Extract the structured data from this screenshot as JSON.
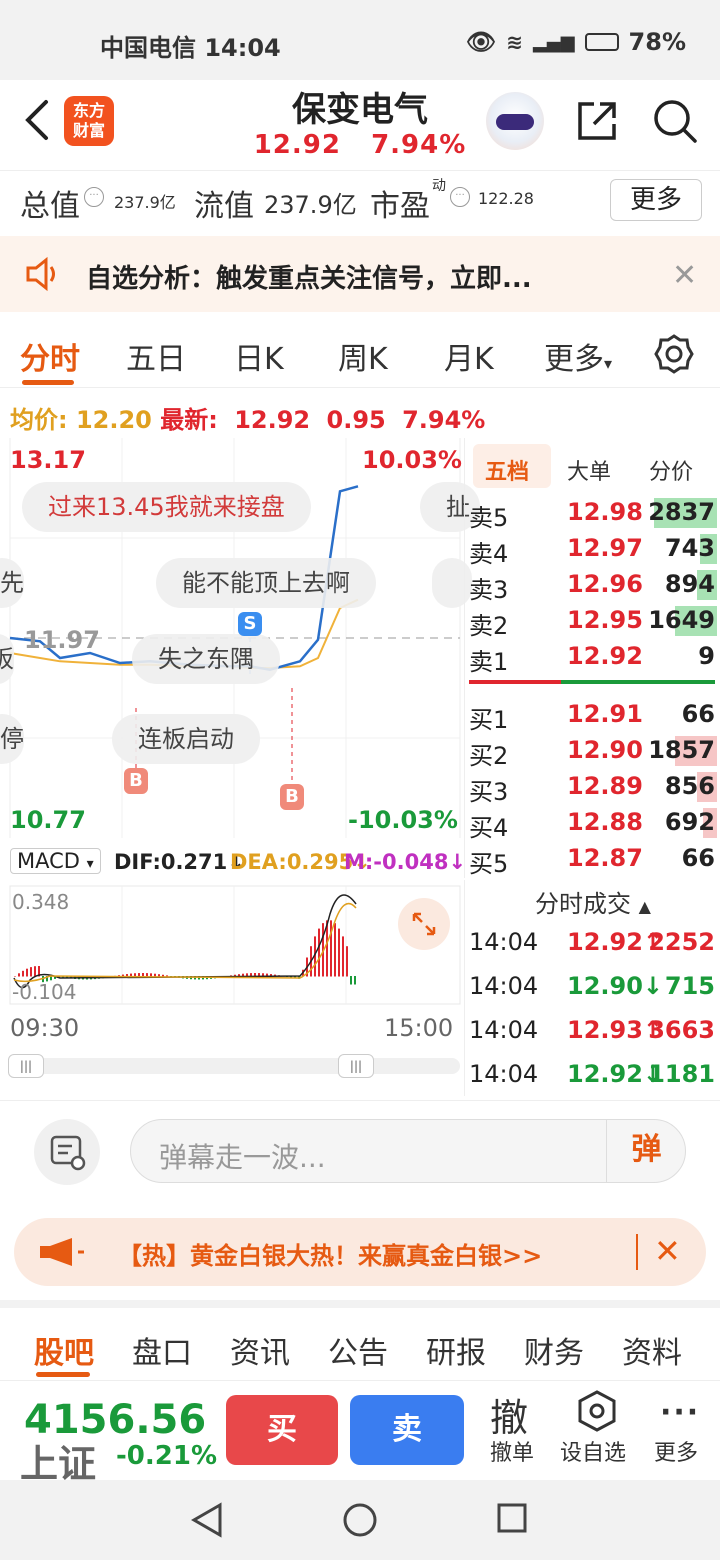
{
  "status_bar": {
    "carrier": "中国电信",
    "time": "14:04",
    "battery": "78%"
  },
  "header": {
    "logo": "东方\n财富",
    "stock_name": "保变电气",
    "price": "12.92",
    "change_pct": "7.94%"
  },
  "metrics": {
    "total_value_label": "总值",
    "total_value": "237.9亿",
    "float_value_label": "流值",
    "float_value": "237.9亿",
    "pe_label": "市盈",
    "pe_sup": "动",
    "pe_value": "122.28",
    "more": "更多"
  },
  "notice": {
    "text": "自选分析：触发重点关注信号，立即..."
  },
  "tabs": [
    "分时",
    "五日",
    "日K",
    "周K",
    "月K",
    "更多"
  ],
  "price_line": {
    "avg_label": "均价:",
    "avg_value": "12.20",
    "latest_label": "最新:",
    "latest_value": "12.92",
    "change": "0.95",
    "change_pct": "7.94%"
  },
  "chart": {
    "y_high": "13.17",
    "y_low": "10.77",
    "pct_high": "10.03%",
    "pct_low": "-10.03%",
    "ref_price": "11.97",
    "bubbles": [
      "过来13.45我就来接盘",
      "能不能顶上去啊",
      "失之东隅",
      "连板启动",
      "扯",
      "板",
      "先",
      "停"
    ],
    "markers": {
      "sell": "S",
      "buy": "B"
    },
    "time_start": "09:30",
    "time_end": "15:00",
    "colors": {
      "price_line": "#2a6fc9",
      "avg_line": "#f0b23a",
      "up": "#e0262e",
      "down": "#1a9a3a"
    }
  },
  "chart_data": {
    "type": "line",
    "series": [
      {
        "name": "price",
        "values": [
          11.97,
          11.95,
          11.85,
          11.88,
          11.82,
          11.83,
          11.81,
          11.8,
          11.8,
          11.78,
          11.83,
          11.96,
          12.85,
          12.88
        ]
      },
      {
        "name": "avg",
        "values": [
          11.88,
          11.85,
          11.83,
          11.82,
          11.81,
          11.81,
          11.8,
          11.8,
          11.79,
          11.79,
          11.8,
          11.85,
          12.15,
          12.2
        ]
      }
    ],
    "x": [
      "09:30",
      "10:00",
      "10:30",
      "11:00",
      "11:30",
      "13:00",
      "13:15",
      "13:30",
      "13:45",
      "13:50",
      "13:55",
      "14:00",
      "14:02",
      "14:04"
    ],
    "ylim": [
      10.77,
      13.17
    ]
  },
  "macd": {
    "label": "MACD",
    "dif": "DIF:0.271",
    "dea": "DEA:0.295",
    "m": "M:-0.048",
    "top": "0.348",
    "bottom": "-0.104"
  },
  "order_book": {
    "tabs": [
      "五档",
      "大单",
      "分价"
    ],
    "asks": [
      {
        "label": "卖5",
        "price": "12.98",
        "vol": "2837",
        "bar": 0.45
      },
      {
        "label": "卖4",
        "price": "12.97",
        "vol": "743",
        "bar": 0.12
      },
      {
        "label": "卖3",
        "price": "12.96",
        "vol": "894",
        "bar": 0.14
      },
      {
        "label": "卖2",
        "price": "12.95",
        "vol": "1649",
        "bar": 0.3
      },
      {
        "label": "卖1",
        "price": "12.92",
        "vol": "9",
        "bar": 0.0
      }
    ],
    "bids": [
      {
        "label": "买1",
        "price": "12.91",
        "vol": "66",
        "bar": 0.0
      },
      {
        "label": "买2",
        "price": "12.90",
        "vol": "1857",
        "bar": 0.3
      },
      {
        "label": "买3",
        "price": "12.89",
        "vol": "856",
        "bar": 0.14
      },
      {
        "label": "买4",
        "price": "12.88",
        "vol": "692",
        "bar": 0.1
      },
      {
        "label": "买5",
        "price": "12.87",
        "vol": "66",
        "bar": 0.0
      }
    ]
  },
  "trades": {
    "title": "分时成交",
    "rows": [
      {
        "time": "14:04",
        "price": "12.92",
        "dir": "↑",
        "vol": "2252",
        "color": "#e0262e"
      },
      {
        "time": "14:04",
        "price": "12.90",
        "dir": "↓",
        "vol": "715",
        "color": "#1a9a3a"
      },
      {
        "time": "14:04",
        "price": "12.93",
        "dir": "↑",
        "vol": "3663",
        "color": "#e0262e"
      },
      {
        "time": "14:04",
        "price": "12.92",
        "dir": "↓",
        "vol": "1181",
        "color": "#1a9a3a"
      }
    ]
  },
  "danmu": {
    "placeholder": "弹幕走一波...",
    "button": "弹"
  },
  "ad": {
    "text": "【热】黄金白银大热！来赢真金白银>>"
  },
  "bottom_tabs": [
    "股吧",
    "盘口",
    "资讯",
    "公告",
    "研报",
    "财务",
    "资料"
  ],
  "action_bar": {
    "index_value": "4156.56",
    "index_name": "上证",
    "index_change": "-0.21%",
    "buy": "买",
    "sell": "卖",
    "cancel_icon": "撤",
    "cancel": "撤单",
    "watch": "设自选",
    "more": "更多"
  }
}
